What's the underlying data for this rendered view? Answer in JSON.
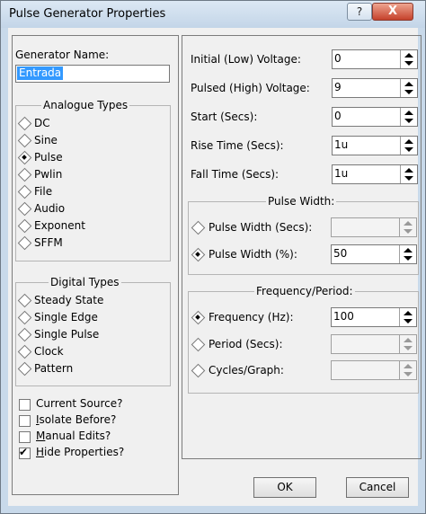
{
  "window": {
    "title": "Pulse Generator Properties",
    "help_label": "?",
    "close_label": "X"
  },
  "generator_name": {
    "label": "Generator Name:",
    "value": "Entrada"
  },
  "analogue_types": {
    "title": "Analogue Types",
    "selected": "Pulse",
    "items": [
      "DC",
      "Sine",
      "Pulse",
      "Pwlin",
      "File",
      "Audio",
      "Exponent",
      "SFFM"
    ]
  },
  "digital_types": {
    "title": "Digital Types",
    "items": [
      "Steady State",
      "Single Edge",
      "Single Pulse",
      "Clock",
      "Pattern"
    ]
  },
  "checkboxes": [
    {
      "label": "Current Source?",
      "checked": false
    },
    {
      "label": "Isolate Before?",
      "checked": false
    },
    {
      "label": "Manual Edits?",
      "checked": false
    },
    {
      "label": "Hide Properties?",
      "checked": true
    }
  ],
  "params": [
    {
      "label": "Initial (Low) Voltage:",
      "value": "0"
    },
    {
      "label": "Pulsed (High) Voltage:",
      "value": "9"
    },
    {
      "label": "Start (Secs):",
      "value": "0"
    },
    {
      "label": "Rise Time (Secs):",
      "value": "1u"
    },
    {
      "label": "Fall Time (Secs):",
      "value": "1u"
    }
  ],
  "pulse_width": {
    "title": "Pulse Width:",
    "selected": "Pulse Width (%):",
    "options": [
      {
        "label": "Pulse Width (Secs):",
        "value": ""
      },
      {
        "label": "Pulse Width (%):",
        "value": "50"
      }
    ]
  },
  "frequency_period": {
    "title": "Frequency/Period:",
    "selected": "Frequency (Hz):",
    "options": [
      {
        "label": "Frequency (Hz):",
        "value": "100"
      },
      {
        "label": "Period (Secs):",
        "value": ""
      },
      {
        "label": "Cycles/Graph:",
        "value": ""
      }
    ]
  },
  "buttons": {
    "ok": "OK",
    "cancel": "Cancel"
  }
}
